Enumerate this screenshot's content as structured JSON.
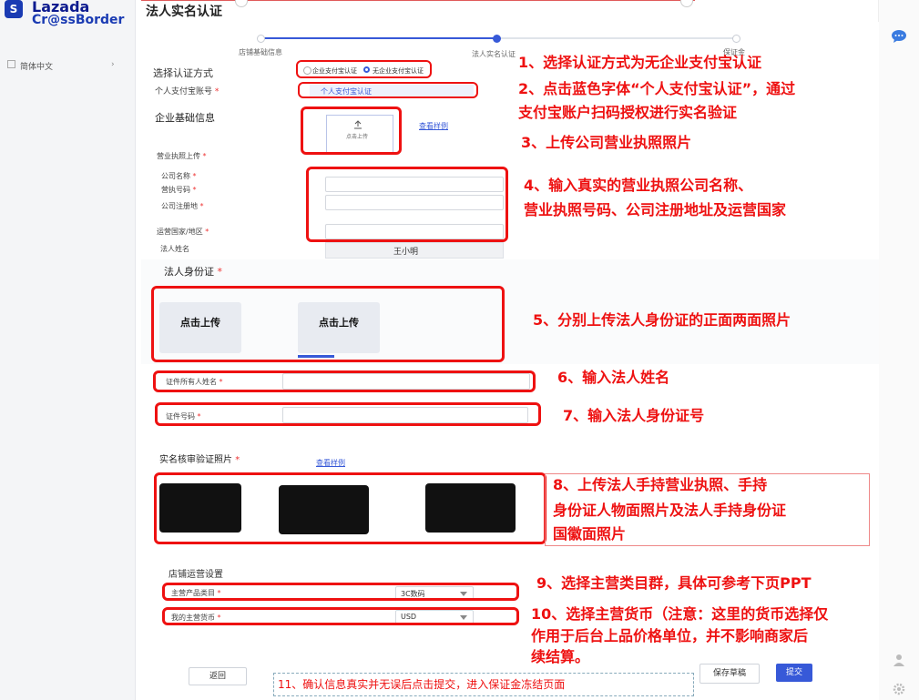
{
  "brand": {
    "logo_badge": "S",
    "name": "Lazada",
    "sub": "Cr@ssBorder"
  },
  "sidebar": {
    "language": "简体中文",
    "chevron": "›"
  },
  "page": {
    "title": "法人实名认证"
  },
  "stepper": {
    "steps": [
      "店铺基础信息",
      "法人实名认证",
      "保证金"
    ],
    "active_index": 1
  },
  "form": {
    "auth_method_label": "选择认证方式",
    "auth_options": [
      "企业支付宝认证",
      "无企业支付宝认证"
    ],
    "auth_selected": "无企业支付宝认证",
    "personal_alipay_label": "个人支付宝账号",
    "personal_alipay_link": "个人支付宝认证",
    "company_info_title": "企业基础信息",
    "license_upload_label": "营业执照上传",
    "upload_text": "点击上传",
    "sample_link": "查看样例",
    "company_name_label": "公司名称",
    "license_no_label": "营执号码",
    "reg_address_label": "公司注册地",
    "country_label": "运营国家/地区",
    "legal_name_label": "法人姓名",
    "legal_name_value": "王小明",
    "id_section_title": "法人身份证",
    "id_front_upload": "点击上传",
    "id_back_upload": "点击上传",
    "id_owner_label": "证件所有人姓名",
    "id_number_label": "证件号码",
    "verify_photo_title": "实名核审验证照片",
    "verify_sample_link": "查看样例",
    "store_ops_title": "店铺运营设置",
    "main_category_label": "主营产品类目",
    "main_category_value": "3C数码",
    "main_currency_label": "我的主营货币",
    "main_currency_value": "USD"
  },
  "buttons": {
    "back": "返回",
    "save_draft": "保存草稿",
    "submit": "提交"
  },
  "annotations": {
    "a1": "1、选择认证方式为无企业支付宝认证",
    "a2_l1": "2、点击蓝色字体“个人支付宝认证”，通过",
    "a2_l2": "支付宝账户扫码授权进行实名验证",
    "a3": "3、上传公司营业执照照片",
    "a4_l1": "4、输入真实的营业执照公司名称、",
    "a4_l2": "营业执照号码、公司注册地址及运营国家",
    "a5": "5、分别上传法人身份证的正面两面照片",
    "a6": "6、输入法人姓名",
    "a7": "7、输入法人身份证号",
    "a8_l1": "8、上传法人手持营业执照、手持",
    "a8_l2": "身份证人物面照片及法人手持身份证",
    "a8_l3": "国徽面照片",
    "a9": "9、选择主营类目群，具体可参考下页PPT",
    "a10_l1": "10、选择主营货币（注意：这里的货币选择仅",
    "a10_l2": "作用于后台上品价格单位，并不影响商家后",
    "a10_l3": "续结算。",
    "a11": "11、确认信息真实并无误后点击提交，进入保证金冻结页面"
  },
  "colors": {
    "accent": "#3759d8",
    "annotation": "#e11111",
    "brand": "#0d1b8f"
  },
  "icons": {
    "chat": "chat-bubble-icon",
    "user": "user-icon",
    "settings": "gear-icon",
    "upload": "upload-icon"
  }
}
